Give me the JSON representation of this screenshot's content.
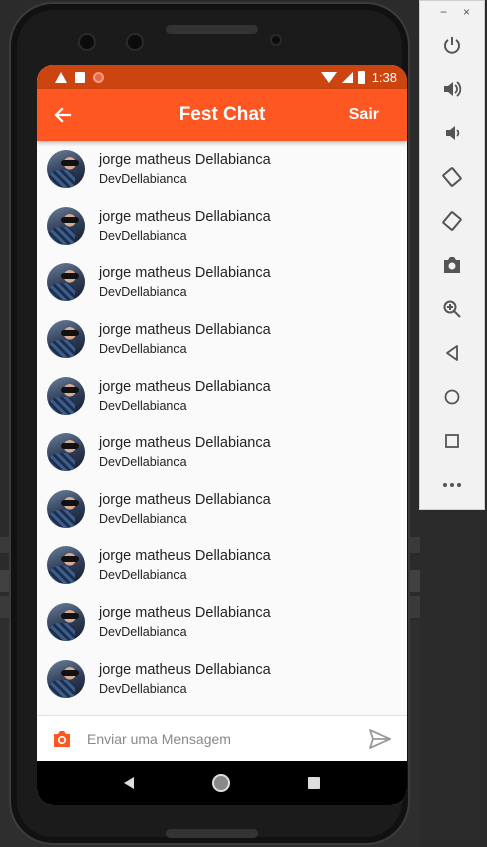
{
  "status_bar": {
    "time": "1:38"
  },
  "app_bar": {
    "title": "Fest Chat",
    "action_label": "Sair"
  },
  "messages": [
    {
      "name": "jorge matheus Dellabianca",
      "text": "DevDellabianca"
    },
    {
      "name": "jorge matheus Dellabianca",
      "text": "DevDellabianca"
    },
    {
      "name": "jorge matheus Dellabianca",
      "text": "DevDellabianca"
    },
    {
      "name": "jorge matheus Dellabianca",
      "text": "DevDellabianca"
    },
    {
      "name": "jorge matheus Dellabianca",
      "text": "DevDellabianca"
    },
    {
      "name": "jorge matheus Dellabianca",
      "text": "DevDellabianca"
    },
    {
      "name": "jorge matheus Dellabianca",
      "text": "DevDellabianca"
    },
    {
      "name": "jorge matheus Dellabianca",
      "text": "DevDellabianca"
    },
    {
      "name": "jorge matheus Dellabianca",
      "text": "DevDellabianca"
    },
    {
      "name": "jorge matheus Dellabianca",
      "text": "DevDellabianca"
    }
  ],
  "composer": {
    "placeholder": "Enviar uma Mensagem"
  },
  "emulator_toolbar": {
    "window_controls": [
      "−",
      "×"
    ],
    "buttons": [
      "power-icon",
      "volume-up-icon",
      "volume-down-icon",
      "rotate-left-icon",
      "rotate-right-icon",
      "camera-icon",
      "zoom-in-icon",
      "back-icon",
      "home-icon",
      "overview-icon",
      "more-icon"
    ]
  },
  "colors": {
    "primary": "#ff5722",
    "status_bar": "#cc4410",
    "background": "#fafafa"
  }
}
